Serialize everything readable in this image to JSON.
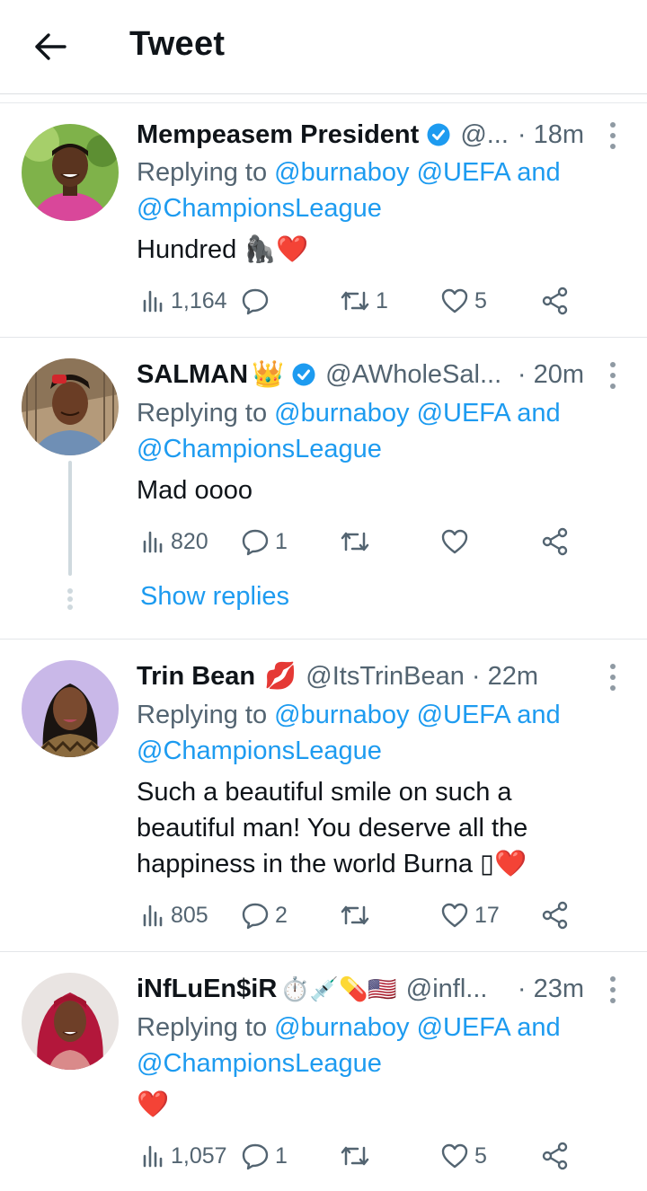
{
  "header": {
    "title": "Tweet"
  },
  "tweets": [
    {
      "name": "Mempeasem President",
      "verified": true,
      "name_emoji": "",
      "handle": "@...",
      "time": "· 18m",
      "replying_prefix": "Replying to ",
      "replying_mentions": "@burnaboy @UEFA and",
      "replying_line2": "@ChampionsLeague",
      "text": "Hundred 🦍❤️",
      "views": "1,164",
      "replies": "",
      "retweets": "1",
      "likes": "5"
    },
    {
      "name": "SALMAN",
      "verified": true,
      "name_emoji": "👑",
      "handle": "@AWholeSal...",
      "time": "· 20m",
      "replying_prefix": "Replying to ",
      "replying_mentions": "@burnaboy @UEFA and",
      "replying_line2": "@ChampionsLeague",
      "text": "Mad oooo",
      "views": "820",
      "replies": "1",
      "retweets": "",
      "likes": "",
      "show_replies": "Show replies"
    },
    {
      "name": "Trin Bean",
      "verified": false,
      "name_emoji": "💋",
      "handle": "@ItsTrinBean",
      "time": "· 22m",
      "replying_prefix": "Replying to ",
      "replying_mentions": "@burnaboy @UEFA and",
      "replying_line2": "@ChampionsLeague",
      "text_lines": [
        "Such a beautiful smile on such a",
        "beautiful man! You deserve all the",
        "happiness in the world Burna ▯❤️"
      ],
      "views": "805",
      "replies": "2",
      "retweets": "",
      "likes": "17"
    },
    {
      "name": "iNfLuEn$iR",
      "verified": false,
      "name_emoji": "⏱️💉💊🇺🇸",
      "handle": "@infl...",
      "time": "· 23m",
      "replying_prefix": "Replying to ",
      "replying_mentions": "@burnaboy @UEFA and",
      "replying_line2": "@ChampionsLeague",
      "text": "❤️",
      "views": "1,057",
      "replies": "1",
      "retweets": "",
      "likes": "5"
    }
  ],
  "colors": {
    "accent": "#1d9bf0",
    "text": "#0f1419",
    "muted": "#536471",
    "divider": "#e3e6e9"
  },
  "icons": [
    "back-arrow-icon",
    "verified-badge-icon",
    "views-icon",
    "reply-icon",
    "retweet-icon",
    "like-icon",
    "share-icon",
    "more-icon"
  ]
}
